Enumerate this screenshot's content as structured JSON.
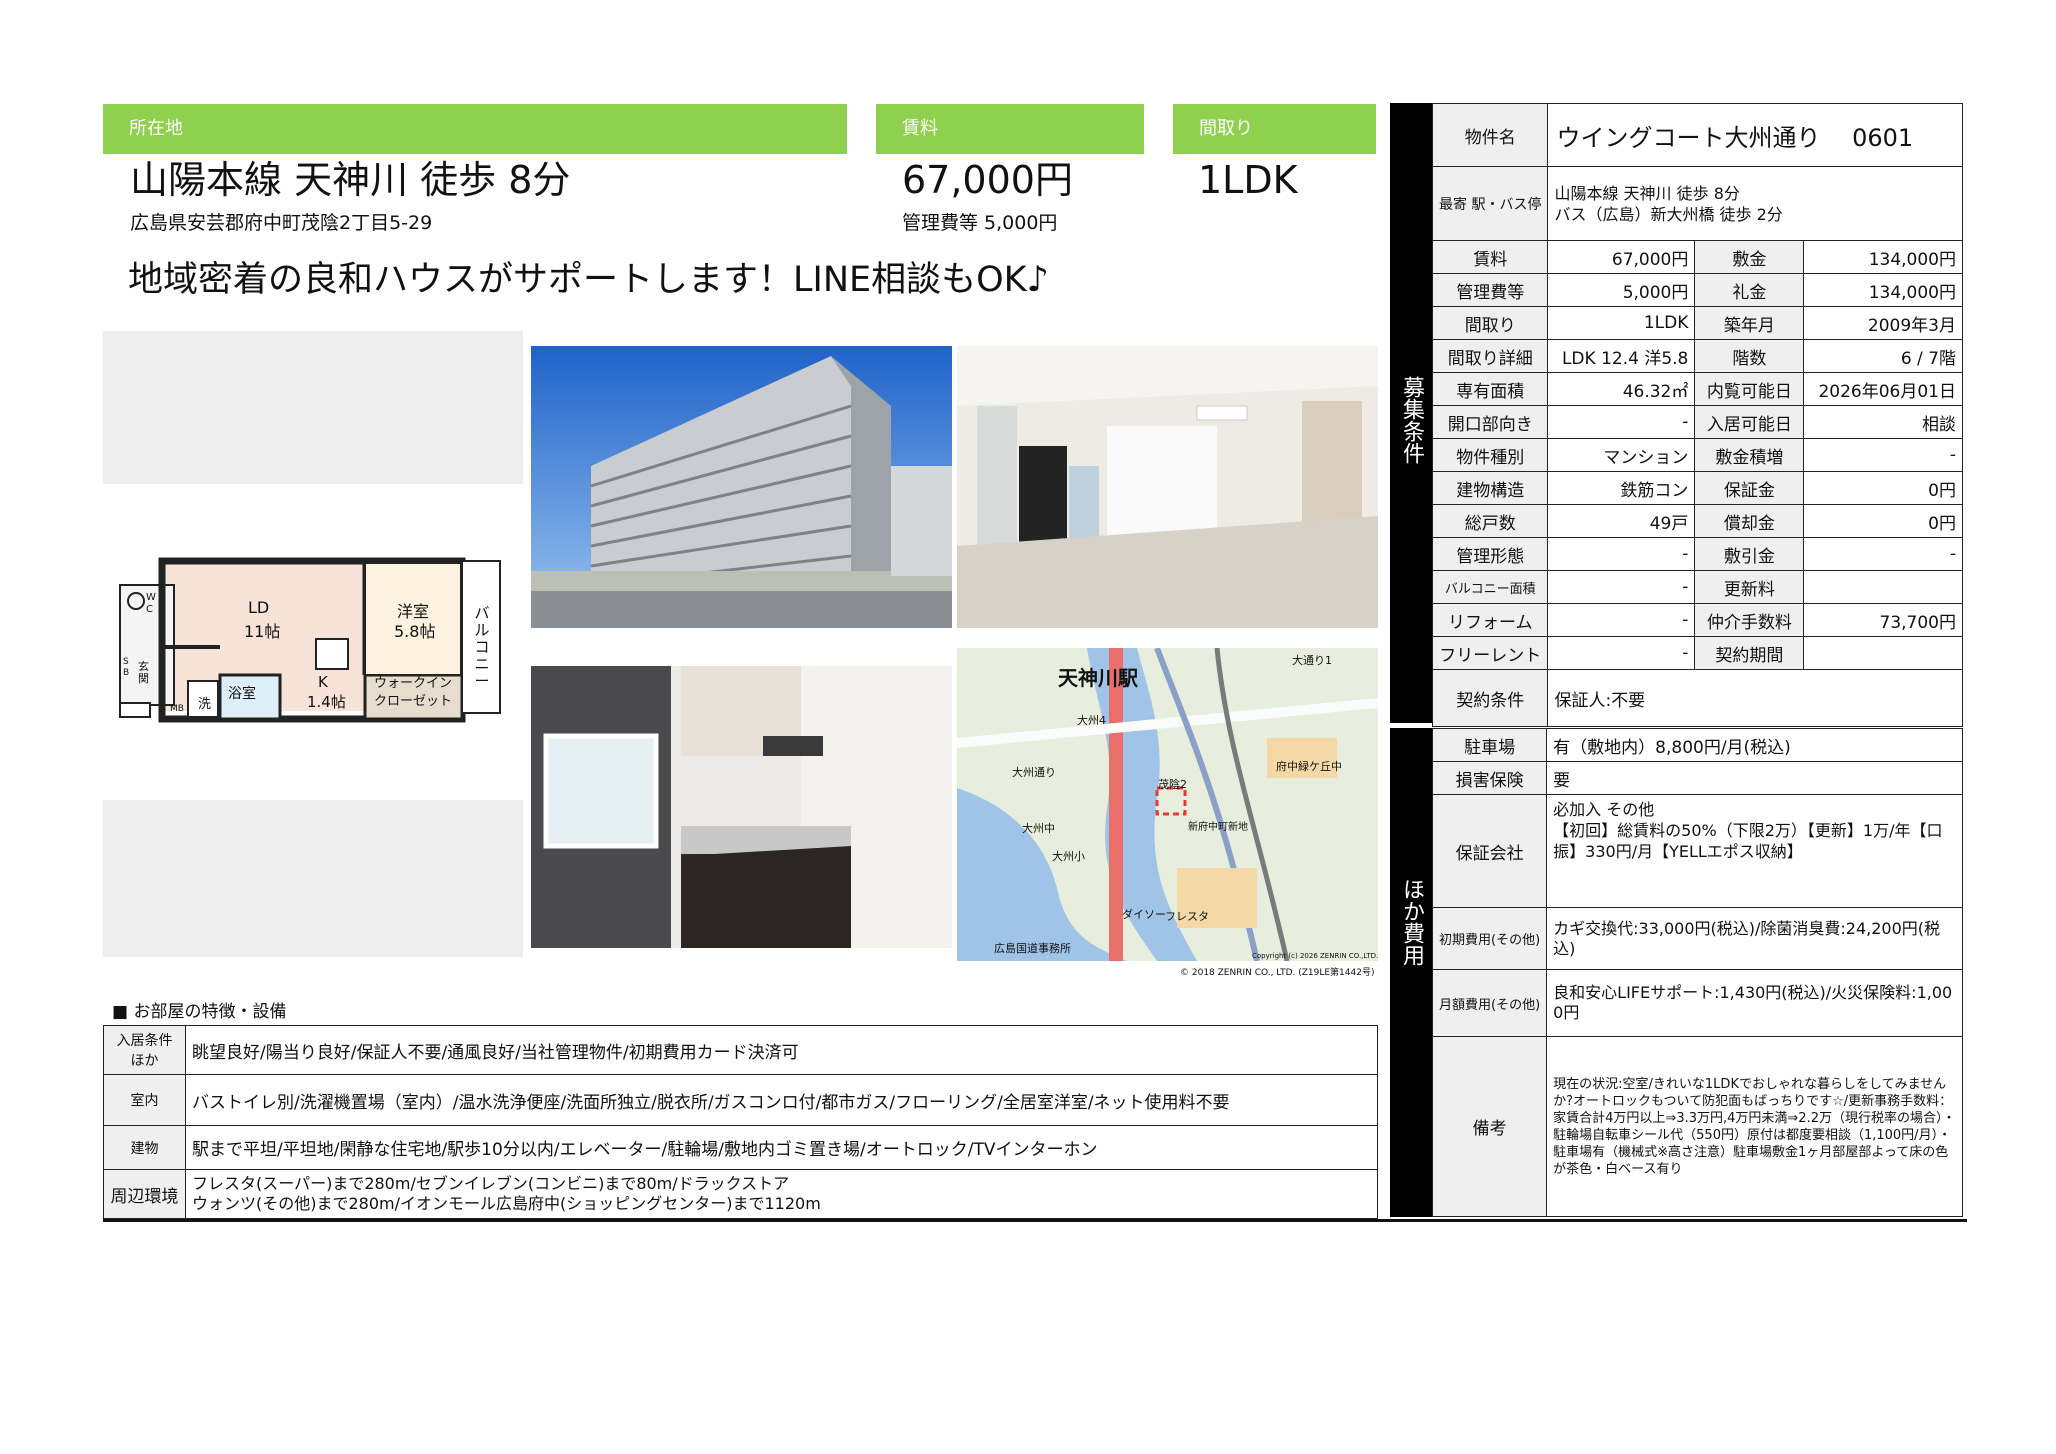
{
  "header": {
    "location_label": "所在地",
    "rent_label": "賃料",
    "layout_label": "間取り",
    "station": "山陽本線 天神川 徒歩 8分",
    "address": "広島県安芸郡府中町茂陰2丁目5-29",
    "rent": "67,000円",
    "management_fee": "管理費等 5,000円",
    "layout": "1LDK",
    "catchphrase": "地域密着の良和ハウスがサポートします！LINE相談もOK♪"
  },
  "floorplan": {
    "ld_label": "LD",
    "ld_size": "11帖",
    "western_label": "洋室",
    "western_size": "5.8帖",
    "k_label": "K",
    "k_size": "1.4帖",
    "walkin_label": "ウォークイン クローゼット",
    "bath_label": "浴室",
    "wash_label": "洗",
    "entrance_label": "玄関",
    "balcony_label": "バルコニー",
    "wc_label": "W C",
    "sb_label": "S B",
    "mb_label": "MB"
  },
  "map": {
    "station_label": "天神川駅",
    "labels": [
      "大通り1",
      "大州通り",
      "大州中",
      "大州小",
      "府中緑ケ丘中",
      "新府中町新地",
      "広島国道事務所",
      "茂陰2",
      "ダイソー",
      "フレスタ",
      "大州4"
    ],
    "copyright": "© 2018 ZENRIN CO., LTD. (Z19LE第1442号)",
    "inner_copyright": "Copyright (c) 2026 ZENRIN CO.,LTD."
  },
  "features": {
    "title": "■ お部屋の特徴・設備",
    "rows": [
      {
        "label": "入居条件ほか",
        "value": "眺望良好/陽当り良好/保証人不要/通風良好/当社管理物件/初期費用カード決済可"
      },
      {
        "label": "室内",
        "value": "バストイレ別/洗濯機置場（室内）/温水洗浄便座/洗面所独立/脱衣所/ガスコンロ付/都市ガス/フローリング/全居室洋室/ネット使用料不要"
      },
      {
        "label": "建物",
        "value": "駅まで平坦/平坦地/閑静な住宅地/駅歩10分以内/エレベーター/駐輪場/敷地内ゴミ置き場/オートロック/TVインターホン"
      },
      {
        "label": "周辺環境",
        "value": "フレスタ(スーパー)まで280m/セブンイレブン(コンビニ)まで80m/ドラックストア\nウォンツ(その他)まで280m/イオンモール広島府中(ショッピングセンター)まで1120m"
      }
    ]
  },
  "recruit": {
    "side_label": "募集条件",
    "property_name_label": "物件名",
    "property_name": "ウイングコート大州通り　 0601",
    "nearest_label": "最寄 駅・バス停",
    "nearest_line1": "山陽本線 天神川 徒歩 8分",
    "nearest_line2": "バス（広島）新大州橋 徒歩 2分",
    "rows": [
      [
        "賃料",
        "67,000円",
        "敷金",
        "134,000円"
      ],
      [
        "管理費等",
        "5,000円",
        "礼金",
        "134,000円"
      ],
      [
        "間取り",
        "1LDK",
        "築年月",
        "2009年3月"
      ],
      [
        "間取り詳細",
        "LDK 12.4 洋5.8",
        "階数",
        "6 / 7階"
      ],
      [
        "専有面積",
        "46.32㎡",
        "内覧可能日",
        "2026年06月01日"
      ],
      [
        "開口部向き",
        "-",
        "入居可能日",
        "相談"
      ],
      [
        "物件種別",
        "マンション",
        "敷金積増",
        "-"
      ],
      [
        "建物構造",
        "鉄筋コン",
        "保証金",
        "0円"
      ],
      [
        "総戸数",
        "49戸",
        "償却金",
        "0円"
      ],
      [
        "管理形態",
        "-",
        "敷引金",
        "-"
      ],
      [
        "バルコニー面積",
        "-",
        "更新料",
        ""
      ],
      [
        "リフォーム",
        "-",
        "仲介手数料",
        "73,700円"
      ],
      [
        "フリーレント",
        "-",
        "契約期間",
        ""
      ]
    ],
    "contract_label": "契約条件",
    "contract_value": "保証人:不要"
  },
  "costs": {
    "side_label": "ほか費用",
    "parking_label": "駐車場",
    "parking_value": "有（敷地内）8,800円/月(税込)",
    "insurance_label": "損害保険",
    "insurance_value": "要",
    "guarantor_label": "保証会社",
    "guarantor_value": "必加入 その他\n【初回】総賃料の50%（下限2万）【更新】1万/年【口振】330円/月【YELLエポス収納】",
    "initial_label": "初期費用(その他)",
    "initial_value": "カギ交換代:33,000円(税込)/除菌消臭費:24,200円(税込)",
    "monthly_label": "月額費用(その他)",
    "monthly_value": "良和安心LIFEサポート:1,430円(税込)/火災保険料:1,000円",
    "remarks_label": "備考",
    "remarks_value": "現在の状況:空室/きれいな1LDKでおしゃれな暮らしをしてみませんか?オートロックもついて防犯面もばっちりです☆/更新事務手数料：家賃合計4万円以上⇒3.3万円,4万円未満⇒2.2万（現行税率の場合）・駐輪場自転車シール代（550円）原付は都度要相談（1,100円/月）・駐車場有（機械式※高さ注意）駐車場敷金1ヶ月部屋部よって床の色が茶色・白ベース有り"
  },
  "colors": {
    "accent_green": "#8fd14f",
    "side_black": "#000000",
    "label_gray": "#efefef"
  }
}
